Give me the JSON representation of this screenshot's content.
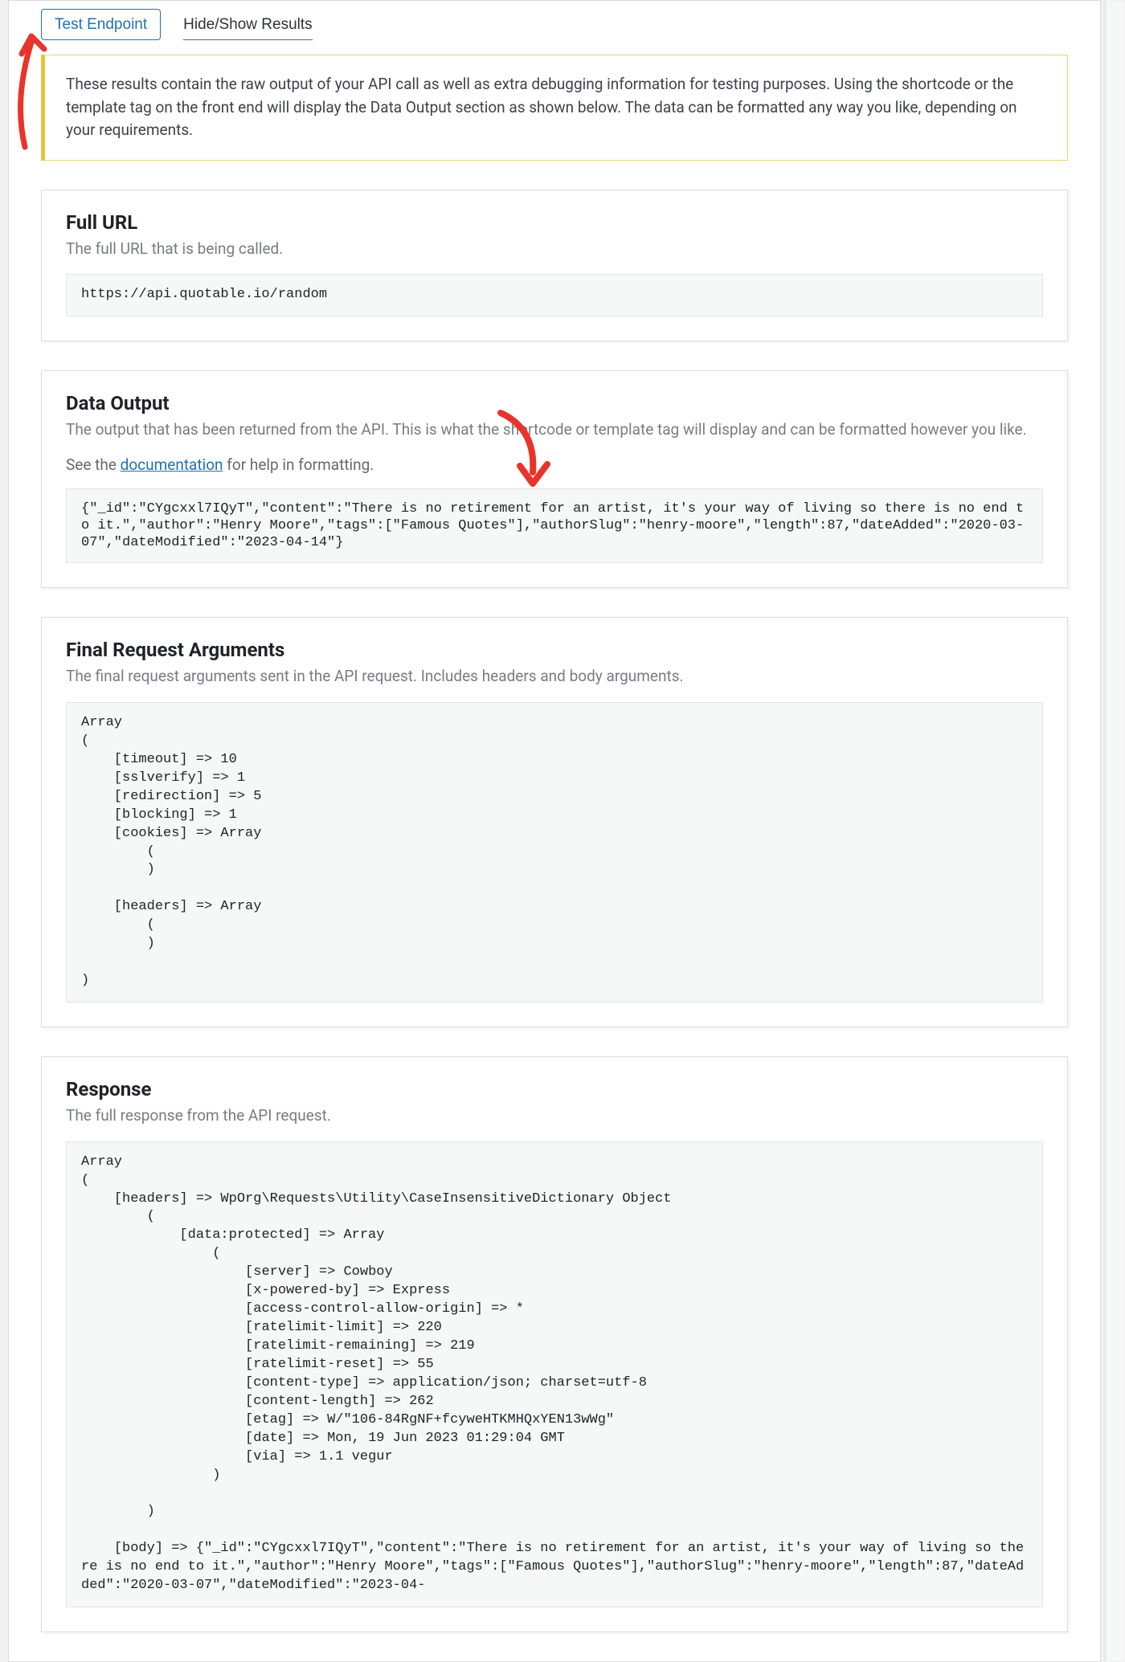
{
  "tabs": {
    "test_endpoint": "Test Endpoint",
    "hide_show": "Hide/Show Results"
  },
  "notice": "These results contain the raw output of your API call as well as extra debugging information for testing purposes. Using the shortcode or the template tag on the front end will display the Data Output section as shown below. The data can be formatted any way you like, depending on your requirements.",
  "panels": {
    "full_url": {
      "title": "Full URL",
      "subtitle": "The full URL that is being called.",
      "code": "https://api.quotable.io/random"
    },
    "data_output": {
      "title": "Data Output",
      "subtitle": "The output that has been returned from the API. This is what the shortcode or template tag will display and can be formatted however you like.",
      "help_prefix": "See the ",
      "help_link": "documentation",
      "help_suffix": " for help in formatting.",
      "code": "{\"_id\":\"CYgcxxl7IQyT\",\"content\":\"There is no retirement for an artist, it's your way of living so there is no end to it.\",\"author\":\"Henry Moore\",\"tags\":[\"Famous Quotes\"],\"authorSlug\":\"henry-moore\",\"length\":87,\"dateAdded\":\"2020-03-07\",\"dateModified\":\"2023-04-14\"}"
    },
    "final_request": {
      "title": "Final Request Arguments",
      "subtitle": "The final request arguments sent in the API request. Includes headers and body arguments.",
      "code": "Array\n(\n    [timeout] => 10\n    [sslverify] => 1\n    [redirection] => 5\n    [blocking] => 1\n    [cookies] => Array\n        (\n        )\n\n    [headers] => Array\n        (\n        )\n\n)"
    },
    "response": {
      "title": "Response",
      "subtitle": "The full response from the API request.",
      "code": "Array\n(\n    [headers] => WpOrg\\Requests\\Utility\\CaseInsensitiveDictionary Object\n        (\n            [data:protected] => Array\n                (\n                    [server] => Cowboy\n                    [x-powered-by] => Express\n                    [access-control-allow-origin] => *\n                    [ratelimit-limit] => 220\n                    [ratelimit-remaining] => 219\n                    [ratelimit-reset] => 55\n                    [content-type] => application/json; charset=utf-8\n                    [content-length] => 262\n                    [etag] => W/\"106-84RgNF+fcyweHTKMHQxYEN13wWg\"\n                    [date] => Mon, 19 Jun 2023 01:29:04 GMT\n                    [via] => 1.1 vegur\n                )\n\n        )\n\n    [body] => {\"_id\":\"CYgcxxl7IQyT\",\"content\":\"There is no retirement for an artist, it's your way of living so there is no end to it.\",\"author\":\"Henry Moore\",\"tags\":[\"Famous Quotes\"],\"authorSlug\":\"henry-moore\",\"length\":87,\"dateAdded\":\"2020-03-07\",\"dateModified\":\"2023-04-"
    }
  }
}
